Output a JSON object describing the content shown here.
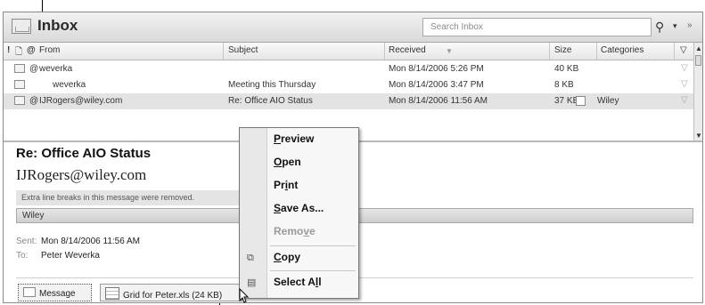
{
  "header": {
    "title": "Inbox",
    "search_placeholder": "Search Inbox",
    "search_icon": "search-icon",
    "search_dropdown_glyph": "▾",
    "expand_glyph": "»"
  },
  "columns": {
    "importance": "!",
    "icon": "🗋",
    "attachment": "@",
    "from": "From",
    "subject": "Subject",
    "received": "Received",
    "size": "Size",
    "categories": "Categories",
    "flag": "▽"
  },
  "messages": [
    {
      "attach": "@",
      "from": "weverka",
      "subject": "",
      "received": "Mon 8/14/2006 5:26 PM",
      "size": "40 KB",
      "category": ""
    },
    {
      "attach": "",
      "from": "weverka",
      "subject": "Meeting this Thursday",
      "received": "Mon 8/14/2006 3:47 PM",
      "size": "8 KB",
      "category": ""
    },
    {
      "attach": "@",
      "from": "IJRogers@wiley.com",
      "subject": "Re: Office AIO Status",
      "received": "Mon 8/14/2006 11:56 AM",
      "size": "37 KB",
      "category": "Wiley"
    }
  ],
  "reading_pane": {
    "subject": "Re: Office AIO Status",
    "from": "IJRogers@wiley.com",
    "infobar": "Extra line breaks in this message were removed.",
    "category": "Wiley",
    "sent_label": "Sent:",
    "sent_value": "Mon 8/14/2006 11:56 AM",
    "to_label": "To:",
    "to_value": "Peter Weverka",
    "tabs": [
      "Message",
      "Grid for Peter.xls (24 KB)"
    ]
  },
  "context_menu": {
    "items": [
      {
        "pre": "",
        "key": "P",
        "post": "review",
        "disabled": false
      },
      {
        "pre": "",
        "key": "O",
        "post": "pen",
        "disabled": false
      },
      {
        "pre": "Pr",
        "key": "i",
        "post": "nt",
        "disabled": false
      },
      {
        "pre": "",
        "key": "S",
        "post": "ave As...",
        "disabled": false
      },
      {
        "pre": "Remo",
        "key": "v",
        "post": "e",
        "disabled": true
      },
      {
        "pre": "",
        "key": "C",
        "post": "opy",
        "disabled": false
      },
      {
        "pre": "Select A",
        "key": "l",
        "post": "l",
        "disabled": false
      }
    ]
  },
  "colors": {
    "header_bg": "#d9d9d9",
    "selected_row": "#e3e3e3",
    "menu_bg": "#f7f7f7"
  }
}
